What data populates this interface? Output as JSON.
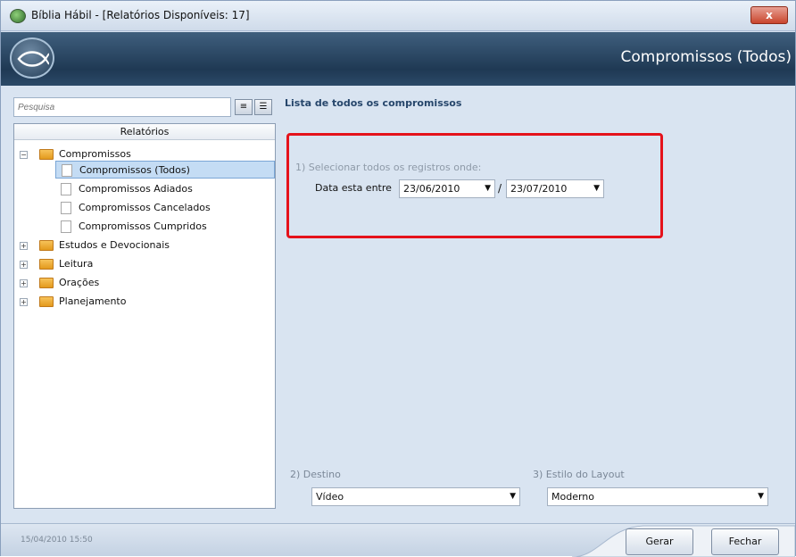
{
  "window": {
    "title": "Bíblia Hábil - [Relatórios Disponíveis: 17]",
    "close_label": "x"
  },
  "header": {
    "title": "Compromissos (Todos)"
  },
  "search": {
    "placeholder": "Pesquisa"
  },
  "tree": {
    "header": "Relatórios",
    "items": [
      {
        "label": "Compromissos",
        "expanded": true
      },
      {
        "label": "Compromissos (Todos)",
        "selected": true
      },
      {
        "label": "Compromissos Adiados"
      },
      {
        "label": "Compromissos Cancelados"
      },
      {
        "label": "Compromissos Cumpridos"
      },
      {
        "label": "Estudos e Devocionais",
        "expanded": false
      },
      {
        "label": "Leitura",
        "expanded": false
      },
      {
        "label": "Orações",
        "expanded": false
      },
      {
        "label": "Planejamento",
        "expanded": false
      }
    ],
    "expanded_symbol": "−",
    "collapsed_symbol": "+"
  },
  "main": {
    "title": "Lista de todos os compromissos",
    "criteria_label": "1) Selecionar todos os registros onde:",
    "date_label": "Data esta entre",
    "date_from": "23/06/2010",
    "date_to": "23/07/2010",
    "date_separator": "/",
    "destination_label": "2) Destino",
    "destination_value": "Vídeo",
    "layout_label": "3) Estilo do Layout",
    "layout_value": "Moderno"
  },
  "status": {
    "timestamp": "15/04/2010 15:50"
  },
  "buttons": {
    "generate": "Gerar",
    "close": "Fechar"
  },
  "colors": {
    "accent_red": "#e5121b",
    "header_dark": "#1f3954",
    "selection": "#c4dcf4"
  }
}
